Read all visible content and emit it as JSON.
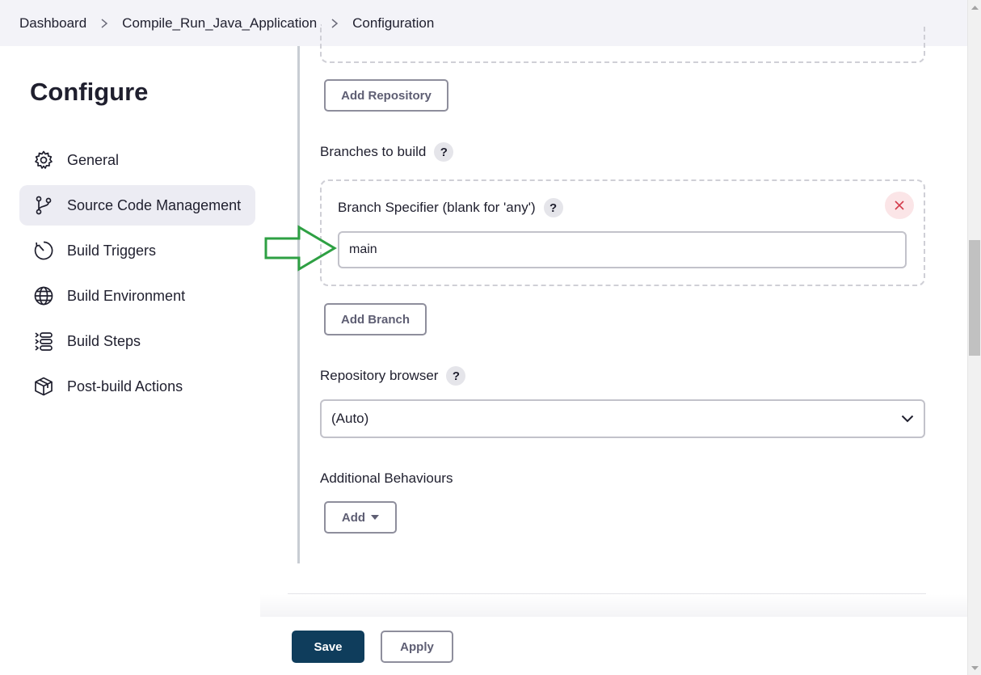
{
  "breadcrumb": {
    "items": [
      "Dashboard",
      "Compile_Run_Java_Application",
      "Configuration"
    ]
  },
  "sidebar": {
    "title": "Configure",
    "items": [
      {
        "label": "General",
        "icon": "gear-icon"
      },
      {
        "label": "Source Code Management",
        "icon": "git-branch-icon",
        "active": true
      },
      {
        "label": "Build Triggers",
        "icon": "clock-icon"
      },
      {
        "label": "Build Environment",
        "icon": "globe-icon"
      },
      {
        "label": "Build Steps",
        "icon": "list-steps-icon"
      },
      {
        "label": "Post-build Actions",
        "icon": "package-icon"
      }
    ]
  },
  "main": {
    "add_repository_label": "Add Repository",
    "branches_to_build_label": "Branches to build",
    "branch_specifier_label": "Branch Specifier (blank for 'any')",
    "branch_specifier_value": "main",
    "add_branch_label": "Add Branch",
    "repository_browser_label": "Repository browser",
    "repository_browser_value": "(Auto)",
    "additional_behaviours_label": "Additional Behaviours",
    "add_label": "Add",
    "help_symbol": "?"
  },
  "footer": {
    "save_label": "Save",
    "apply_label": "Apply"
  },
  "colors": {
    "save_bg": "#0f3d5c",
    "annotation_arrow": "#2ea043",
    "delete_icon": "#d33a4a",
    "active_nav_bg": "#ececf3"
  }
}
